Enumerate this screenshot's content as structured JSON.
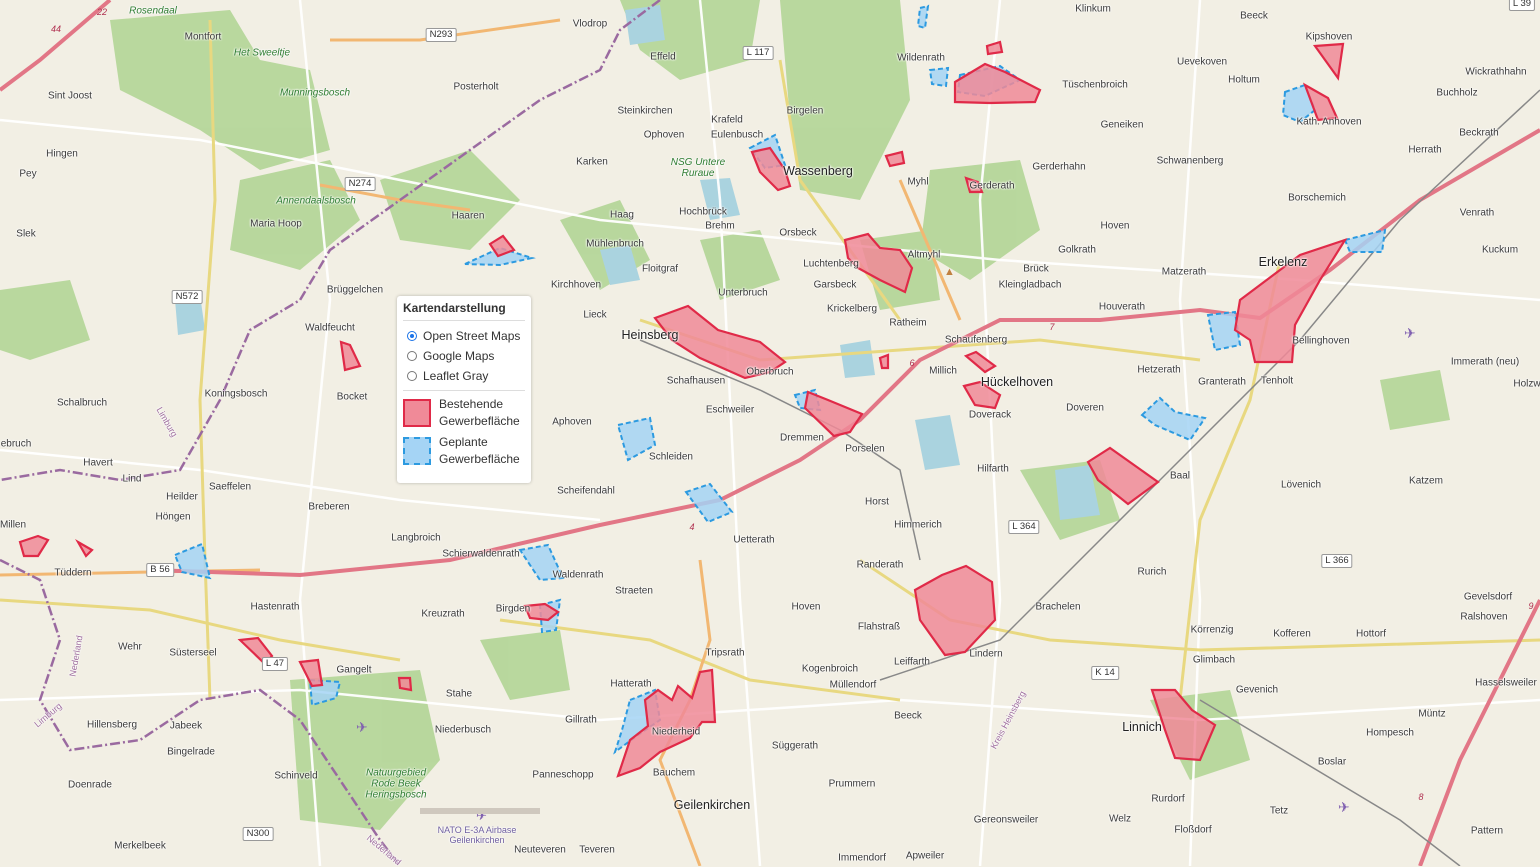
{
  "legend": {
    "title": "Kartendarstellung",
    "options": [
      {
        "label": "Open Street Maps",
        "checked": true
      },
      {
        "label": "Google Maps",
        "checked": false
      },
      {
        "label": "Leaflet Gray",
        "checked": false
      }
    ],
    "items": [
      {
        "line1": "Bestehende",
        "line2": "Gewerbefläche"
      },
      {
        "line1": "Geplante",
        "line2": "Gewerbefläche"
      }
    ]
  },
  "colors": {
    "existing_fill": "#f08a98",
    "existing_stroke": "#e02a48",
    "planned_fill": "#a5d4f5",
    "planned_stroke": "#2c9ae0",
    "map_background": "#f2efe4",
    "forest": "#b5d69a",
    "water": "#aad3df"
  },
  "towns": {
    "heinsberg": "Heinsberg",
    "huckelhoven": "Hückelhoven",
    "erkelenz": "Erkelenz",
    "geilenkirchen": "Geilenkirchen",
    "wassenberg": "Wassenberg",
    "linnich": "Linnich"
  },
  "places": {
    "rosendaal": "Rosendaal",
    "montfort": "Montfort",
    "het_sweeltje": "Het Sweeltje",
    "munningsbosch": "Munningsbosch",
    "sint_joost": "Sint Joost",
    "posterholt": "Posterholt",
    "vlodrop": "Vlodrop",
    "effeld": "Effeld",
    "wildenrath": "Wildenrath",
    "klinkum": "Klinkum",
    "beeck_n": "Beeck",
    "kipshoven": "Kipshoven",
    "uevekoven": "Uevekoven",
    "holtum": "Holtum",
    "wickrathhahn": "Wickrathhahn",
    "tuschenbroich": "Tüschenbroich",
    "buchholz": "Buchholz",
    "geneiken": "Geneiken",
    "kath_anhoven": "Kath. Anhoven",
    "beckrath": "Beckrath",
    "hingen": "Hingen",
    "pey": "Pey",
    "steinkirchen": "Steinkirchen",
    "birgelen": "Birgelen",
    "krafeld": "Krafeld",
    "eulenbusch": "Eulenbusch",
    "ophoven": "Ophoven",
    "karken": "Karken",
    "nsg": "NSG Untere Ruraue",
    "myhl": "Myhl",
    "gerderhahn": "Gerderhahn",
    "schwanenberg": "Schwanenberg",
    "herrath": "Herrath",
    "gerderath": "Gerderath",
    "annendaalsbosch": "Annendaalsbosch",
    "maria_hoop": "Maria Hoop",
    "slek": "Slek",
    "haaren": "Haaren",
    "haag": "Haag",
    "hochbruck": "Hochbrück",
    "brehm": "Brehm",
    "orsbeck": "Orsbeck",
    "borschemich": "Borschemich",
    "venrath": "Venrath",
    "muhlenbruch": "Mühlenbruch",
    "golkrath": "Golkrath",
    "hoven_n": "Hoven",
    "kuckum": "Kuckum",
    "altmyhl": "Altmyhl",
    "luchtenberg": "Luchtenberg",
    "floitgraf": "Floitgraf",
    "kirchhoven": "Kirchhoven",
    "bruck": "Brück",
    "matzerath": "Matzerath",
    "bruggelchen": "Brüggelchen",
    "garsbeck": "Garsbeck",
    "kleingladbach": "Kleingladbach",
    "unterbruch": "Unterbruch",
    "houverath": "Houverath",
    "lieck": "Lieck",
    "krickelberg": "Krickelberg",
    "ratheim": "Ratheim",
    "waldfeucht": "Waldfeucht",
    "schaufenberg": "Schaufenberg",
    "bellinghoven": "Bellinghoven",
    "immerath": "Immerath (neu)",
    "schafhausen": "Schafhausen",
    "oberbruch": "Oberbruch",
    "millich": "Millich",
    "hetzerath": "Hetzerath",
    "granterath": "Granterath",
    "tenholt": "Tenholt",
    "schalbruch": "Schalbruch",
    "koningsbosch": "Koningsbosch",
    "bocket": "Bocket",
    "aphoven": "Aphoven",
    "eschweiler": "Eschweiler",
    "doveren": "Doveren",
    "doverack": "Doverack",
    "holzw": "Holzw",
    "dremmen": "Dremmen",
    "porselen": "Porselen",
    "ebruch": "ebruch",
    "havert": "Havert",
    "schleiden": "Schleiden",
    "hilfarth": "Hilfarth",
    "baal": "Baal",
    "lind": "Lind",
    "heilder": "Heilder",
    "saeffelen": "Saeffelen",
    "lovenich": "Lövenich",
    "katzem": "Katzem",
    "hongen": "Höngen",
    "scheifendahl": "Scheifendahl",
    "horst": "Horst",
    "breberen": "Breberen",
    "millen": "Millen",
    "himmerich": "Himmerich",
    "langbroich": "Langbroich",
    "uetterath": "Uetterath",
    "tuddern": "Tüddern",
    "schierwaldenrath": "Schierwaldenrath",
    "randerath": "Randerath",
    "waldenrath": "Waldenrath",
    "rurich": "Rurich",
    "straeten": "Straeten",
    "gevelsdorf": "Gevelsdorf",
    "hastenrath": "Hastenrath",
    "birgden": "Birgden",
    "hoven_s": "Hoven",
    "brachelen": "Brachelen",
    "kreuzrath": "Kreuzrath",
    "ralshoven": "Ralshoven",
    "korrenzig": "Körrenzig",
    "kofferen": "Kofferen",
    "hottorf": "Hottorf",
    "flahstrass": "Flahstraß",
    "wehr": "Wehr",
    "susterseel": "Süsterseel",
    "tripsrath": "Tripsrath",
    "gangelt": "Gangelt",
    "leiffarth": "Leiffarth",
    "lindern": "Lindern",
    "glimbach": "Glimbach",
    "kogenbroich": "Kogenbroich",
    "hatterath": "Hatterath",
    "gevenich": "Gevenich",
    "hasselsweiler": "Hasselsweiler",
    "stahe": "Stahe",
    "mullendorf": "Müllendorf",
    "hillensberg": "Hillensberg",
    "jabeek": "Jabeek",
    "gillrath": "Gillrath",
    "beeck_s": "Beeck",
    "muntz": "Müntz",
    "niederbusch": "Niederbusch",
    "niederheid": "Niederheid",
    "hompesch": "Hompesch",
    "suggerath": "Süggerath",
    "boslar": "Boslar",
    "bingelrade": "Bingelrade",
    "schinveld": "Schinveld",
    "bauchem": "Bauchem",
    "panneschopp": "Panneschopp",
    "natuurgebied": "Natuurgebied Rode Beek Heringsbosch",
    "doenrade": "Doenrade",
    "prummern": "Prummern",
    "rurdorf": "Rurdorf",
    "tetz": "Tetz",
    "nato": "NATO E-3A Airbase Geilenkirchen",
    "welz": "Welz",
    "flossdorf": "Floßdorf",
    "gereonsweiler": "Gereonsweiler",
    "pattern": "Pattern",
    "merkelbeek": "Merkelbeek",
    "neuteveren": "Neuteveren",
    "teveren": "Teveren",
    "immendorf": "Immendorf",
    "apweiler": "Apweiler",
    "kreis_heinsberg": "Kreis Heinsberg",
    "limburg_w": "Limburg",
    "nederland_w": "Nederland",
    "limburg_s": "Limburg",
    "nederland_s": "Nederland"
  },
  "roads": {
    "n293": "N293",
    "l117": "L 117",
    "n274": "N274",
    "n572": "N572",
    "l364": "L 364",
    "l366": "L 366",
    "b56": "B 56",
    "l47": "L 47",
    "k14": "K 14",
    "n300": "N300",
    "l39": "L 39",
    "a44": "44",
    "r22": "22",
    "r7": "7",
    "r6": "6",
    "r4": "4",
    "r9": "9",
    "r8": "8"
  }
}
